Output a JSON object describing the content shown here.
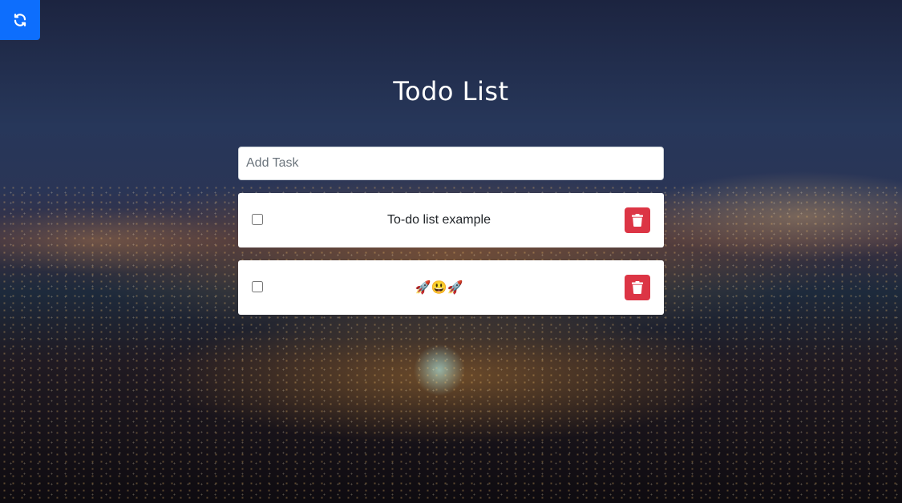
{
  "header": {
    "title": "Todo List",
    "refresh_icon": "refresh-icon"
  },
  "add_task": {
    "placeholder": "Add Task",
    "value": ""
  },
  "tasks": [
    {
      "text": "To-do list example",
      "checked": false,
      "delete_icon": "trash-icon"
    },
    {
      "text": "🚀😃🚀",
      "checked": false,
      "delete_icon": "trash-icon"
    }
  ],
  "colors": {
    "refresh_button": "#0d6efd",
    "delete_button": "#dc3545",
    "card_background": "#ffffff",
    "title_text": "#ffffff"
  }
}
